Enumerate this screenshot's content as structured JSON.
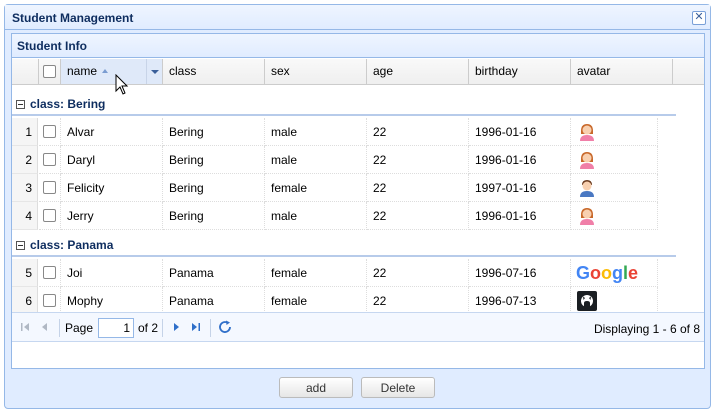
{
  "window": {
    "title": "Student Management"
  },
  "panel": {
    "title": "Student Info"
  },
  "grid": {
    "columns": [
      "name",
      "class",
      "sex",
      "age",
      "birthday",
      "avatar"
    ],
    "groups": [
      {
        "label": "class: Bering",
        "rows": [
          {
            "num": "1",
            "name": "Alvar",
            "class": "Bering",
            "sex": "male",
            "age": "22",
            "birthday": "1996-01-16",
            "avatar": "female-avatar-icon"
          },
          {
            "num": "2",
            "name": "Daryl",
            "class": "Bering",
            "sex": "male",
            "age": "22",
            "birthday": "1996-01-16",
            "avatar": "female-avatar-icon"
          },
          {
            "num": "3",
            "name": "Felicity",
            "class": "Bering",
            "sex": "female",
            "age": "22",
            "birthday": "1997-01-16",
            "avatar": "male-avatar-icon"
          },
          {
            "num": "4",
            "name": "Jerry",
            "class": "Bering",
            "sex": "male",
            "age": "22",
            "birthday": "1996-01-16",
            "avatar": "female-avatar-icon"
          }
        ]
      },
      {
        "label": "class: Panama",
        "rows": [
          {
            "num": "5",
            "name": "Joi",
            "class": "Panama",
            "sex": "female",
            "age": "22",
            "birthday": "1996-07-16",
            "avatar": "google-logo"
          },
          {
            "num": "6",
            "name": "Mophy",
            "class": "Panama",
            "sex": "female",
            "age": "22",
            "birthday": "1996-07-13",
            "avatar": "github-logo"
          }
        ]
      }
    ]
  },
  "pager": {
    "page_label": "Page",
    "page_value": "1",
    "of_label": "of 2",
    "display_text": "Displaying 1 - 6 of 8"
  },
  "buttons": {
    "add": "add",
    "delete": "Delete"
  },
  "logos": {
    "google": "Google"
  },
  "colors": {
    "accent": "#95b8e7",
    "title": "#0e2d5f"
  }
}
